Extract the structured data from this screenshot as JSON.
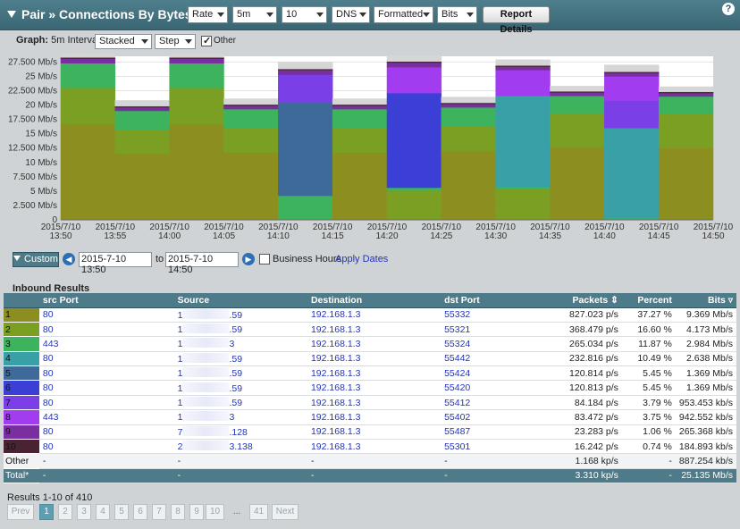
{
  "header": {
    "title": "Pair » Connections By Bytes",
    "selects": [
      {
        "name": "metric-select",
        "value": "Rate"
      },
      {
        "name": "interval-select",
        "value": "5m"
      },
      {
        "name": "topn-select",
        "value": "10"
      },
      {
        "name": "dns-select",
        "value": "DNS"
      },
      {
        "name": "format-select",
        "value": "Formatted"
      },
      {
        "name": "units-select",
        "value": "Bits"
      }
    ],
    "report_button": "Report Details",
    "help": "?"
  },
  "graph": {
    "label": "Graph:",
    "interval": "5m Interval",
    "mode": "Stacked",
    "style": "Step",
    "other_label": "Other",
    "other_checked": true
  },
  "range": {
    "custom_label": "Custom",
    "from": "2015-7-10 13:50",
    "to_label": "to",
    "to": "2015-7-10 14:50",
    "business_hours": "Business Hours",
    "apply": "Apply Dates"
  },
  "chart_data": {
    "type": "area",
    "stacked": true,
    "step": true,
    "x": [
      "2015/7/10 13:50",
      "2015/7/10 13:55",
      "2015/7/10 14:00",
      "2015/7/10 14:05",
      "2015/7/10 14:10",
      "2015/7/10 14:15",
      "2015/7/10 14:20",
      "2015/7/10 14:25",
      "2015/7/10 14:30",
      "2015/7/10 14:35",
      "2015/7/10 14:40",
      "2015/7/10 14:45"
    ],
    "x_ticks": [
      "2015/7/10\n13:50",
      "2015/7/10\n13:55",
      "2015/7/10\n14:00",
      "2015/7/10\n14:05",
      "2015/7/10\n14:10",
      "2015/7/10\n14:15",
      "2015/7/10\n14:20",
      "2015/7/10\n14:25",
      "2015/7/10\n14:30",
      "2015/7/10\n14:35",
      "2015/7/10\n14:40",
      "2015/7/10\n14:45",
      "2015/7/10\n14:50"
    ],
    "y_ticks": [
      "0",
      "2.500 Mb/s",
      "5 Mb/s",
      "7.500 Mb/s",
      "10 Mb/s",
      "12.500 Mb/s",
      "15 Mb/s",
      "17.500 Mb/s",
      "20 Mb/s",
      "22.500 Mb/s",
      "25 Mb/s",
      "27.500 Mb/s"
    ],
    "ylim": [
      0,
      28.5
    ],
    "series": [
      {
        "color": "#8c8f1f",
        "values": [
          16.7,
          11.5,
          16.7,
          11.7,
          0,
          11.7,
          0,
          12.0,
          0,
          12.6,
          0,
          12.5
        ]
      },
      {
        "color": "#7a9f22",
        "values": [
          6.3,
          4.2,
          6.3,
          4.3,
          0,
          4.3,
          5.2,
          4.3,
          5.4,
          6.0,
          0,
          6.0
        ]
      },
      {
        "color": "#3db35e",
        "values": [
          4.3,
          3.3,
          4.3,
          3.3,
          4.2,
          3.3,
          0.4,
          3.3,
          0.4,
          3.0,
          0.3,
          3.0
        ]
      },
      {
        "color": "#3aa0a8",
        "values": [
          0,
          0,
          0,
          0,
          0,
          0,
          0,
          0,
          15.8,
          0,
          15.7,
          0
        ]
      },
      {
        "color": "#3d6a99",
        "values": [
          0,
          0,
          0,
          0,
          16.3,
          0,
          0,
          0,
          0,
          0,
          0,
          0
        ]
      },
      {
        "color": "#3c3fd6",
        "values": [
          0,
          0,
          0,
          0,
          0,
          0,
          16.5,
          0,
          0,
          0,
          0,
          0
        ]
      },
      {
        "color": "#7a3fe6",
        "values": [
          0,
          0,
          0,
          0,
          4.8,
          0,
          0,
          0,
          0,
          0,
          4.8,
          0
        ]
      },
      {
        "color": "#a23cf0",
        "values": [
          0,
          0,
          0,
          0,
          0,
          0,
          4.5,
          0,
          4.5,
          0,
          4.2,
          0
        ]
      },
      {
        "color": "#7a2fa0",
        "values": [
          0.8,
          0.6,
          0.8,
          0.6,
          0.8,
          0.6,
          0.8,
          0.6,
          0.6,
          0.6,
          0.6,
          0.6
        ]
      },
      {
        "color": "#4a2332",
        "values": [
          0.2,
          0.2,
          0.2,
          0.2,
          0.2,
          0.2,
          0.2,
          0.2,
          0.2,
          0.2,
          0.2,
          0.2
        ]
      },
      {
        "color": "#d6d6d6",
        "values": [
          0.6,
          1.0,
          0.6,
          1.0,
          1.2,
          1.0,
          1.0,
          1.0,
          1.0,
          0.9,
          1.2,
          0.9
        ]
      }
    ]
  },
  "results": {
    "heading": "Inbound Results",
    "columns": [
      "src Port",
      "Source",
      "Destination",
      "dst Port",
      "Packets",
      "Percent",
      "Bits"
    ],
    "rows": [
      {
        "n": "1",
        "color": "#8c8f1f",
        "src_port": "80",
        "source_a": "1",
        "source_b": ".59",
        "destination": "192.168.1.3",
        "dst_port": "55332",
        "packets": "827.023 p/s",
        "percent": "37.27 %",
        "bits": "9.369 Mb/s"
      },
      {
        "n": "2",
        "color": "#7a9f22",
        "src_port": "80",
        "source_a": "1",
        "source_b": ".59",
        "destination": "192.168.1.3",
        "dst_port": "55321",
        "packets": "368.479 p/s",
        "percent": "16.60 %",
        "bits": "4.173 Mb/s"
      },
      {
        "n": "3",
        "color": "#3db35e",
        "src_port": "443",
        "source_a": "1",
        "source_b": "3",
        "destination": "192.168.1.3",
        "dst_port": "55324",
        "packets": "265.034 p/s",
        "percent": "11.87 %",
        "bits": "2.984 Mb/s"
      },
      {
        "n": "4",
        "color": "#3aa0a8",
        "src_port": "80",
        "source_a": "1",
        "source_b": ".59",
        "destination": "192.168.1.3",
        "dst_port": "55442",
        "packets": "232.816 p/s",
        "percent": "10.49 %",
        "bits": "2.638 Mb/s"
      },
      {
        "n": "5",
        "color": "#3d6a99",
        "src_port": "80",
        "source_a": "1",
        "source_b": ".59",
        "destination": "192.168.1.3",
        "dst_port": "55424",
        "packets": "120.814 p/s",
        "percent": "5.45 %",
        "bits": "1.369 Mb/s"
      },
      {
        "n": "6",
        "color": "#3c3fd6",
        "src_port": "80",
        "source_a": "1",
        "source_b": ".59",
        "destination": "192.168.1.3",
        "dst_port": "55420",
        "packets": "120.813 p/s",
        "percent": "5.45 %",
        "bits": "1.369 Mb/s"
      },
      {
        "n": "7",
        "color": "#7a3fe6",
        "src_port": "80",
        "source_a": "1",
        "source_b": ".59",
        "destination": "192.168.1.3",
        "dst_port": "55412",
        "packets": "84.184 p/s",
        "percent": "3.79 %",
        "bits": "953.453 kb/s"
      },
      {
        "n": "8",
        "color": "#a23cf0",
        "src_port": "443",
        "source_a": "1",
        "source_b": "3",
        "destination": "192.168.1.3",
        "dst_port": "55402",
        "packets": "83.472 p/s",
        "percent": "3.75 %",
        "bits": "942.552 kb/s"
      },
      {
        "n": "9",
        "color": "#7a2fa0",
        "src_port": "80",
        "source_a": "7",
        "source_b": ".128",
        "destination": "192.168.1.3",
        "dst_port": "55487",
        "packets": "23.283 p/s",
        "percent": "1.06 %",
        "bits": "265.368 kb/s"
      },
      {
        "n": "10",
        "color": "#4a2332",
        "src_port": "80",
        "source_a": "2",
        "source_b": "3.138",
        "destination": "192.168.1.3",
        "dst_port": "55301",
        "packets": "16.242 p/s",
        "percent": "0.74 %",
        "bits": "184.893 kb/s"
      }
    ],
    "other": {
      "label": "Other",
      "src_port": "-",
      "source": "-",
      "destination": "-",
      "dst_port": "-",
      "packets": "1.168 kp/s",
      "percent": "-",
      "bits": "887.254 kb/s"
    },
    "total": {
      "label": "Total*",
      "src_port": "-",
      "source": "-",
      "destination": "-",
      "dst_port": "-",
      "packets": "3.310 kp/s",
      "percent": "-",
      "bits": "25.135 Mb/s"
    },
    "summary": "Results 1-10 of 410"
  },
  "pagination": {
    "prev": "Prev",
    "pages": [
      "1",
      "2",
      "3",
      "4",
      "5",
      "6",
      "7",
      "8",
      "9",
      "10"
    ],
    "ellipsis": "...",
    "last": "41",
    "next": "Next"
  }
}
